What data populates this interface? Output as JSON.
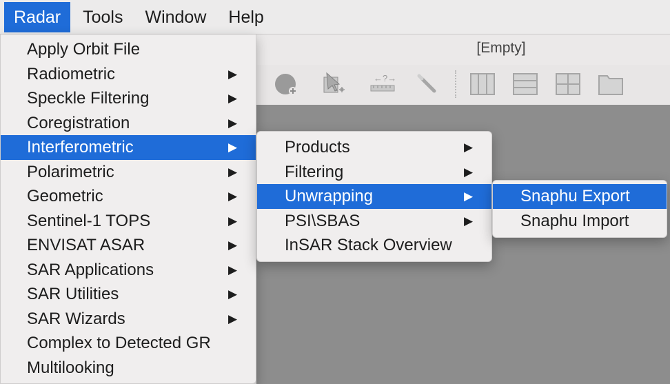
{
  "menubar": {
    "items": [
      {
        "label": "Radar",
        "active": true
      },
      {
        "label": "Tools",
        "active": false
      },
      {
        "label": "Window",
        "active": false
      },
      {
        "label": "Help",
        "active": false
      }
    ]
  },
  "window": {
    "title": "[Empty]"
  },
  "toolbar": {
    "icons": [
      "new-product-icon",
      "select-tool-icon",
      "measure-tool-icon",
      "magic-wand-icon",
      "tile-columns-icon",
      "tile-rows-icon",
      "tile-grid-icon",
      "tile-floating-icon"
    ]
  },
  "radar_menu": {
    "items": [
      {
        "label": "Apply Orbit File",
        "submenu": false
      },
      {
        "label": "Radiometric",
        "submenu": true
      },
      {
        "label": "Speckle Filtering",
        "submenu": true
      },
      {
        "label": "Coregistration",
        "submenu": true
      },
      {
        "label": "Interferometric",
        "submenu": true,
        "highlight": true
      },
      {
        "label": "Polarimetric",
        "submenu": true
      },
      {
        "label": "Geometric",
        "submenu": true
      },
      {
        "label": "Sentinel-1 TOPS",
        "submenu": true
      },
      {
        "label": "ENVISAT ASAR",
        "submenu": true
      },
      {
        "label": "SAR Applications",
        "submenu": true
      },
      {
        "label": "SAR Utilities",
        "submenu": true
      },
      {
        "label": "SAR Wizards",
        "submenu": true
      },
      {
        "label": "Complex to Detected GR",
        "submenu": false
      },
      {
        "label": "Multilooking",
        "submenu": false
      }
    ]
  },
  "interferometric_menu": {
    "items": [
      {
        "label": "Products",
        "submenu": true
      },
      {
        "label": "Filtering",
        "submenu": true
      },
      {
        "label": "Unwrapping",
        "submenu": true,
        "highlight": true
      },
      {
        "label": "PSI\\SBAS",
        "submenu": true
      },
      {
        "label": "InSAR Stack Overview",
        "submenu": false
      }
    ]
  },
  "unwrapping_menu": {
    "items": [
      {
        "label": "Snaphu Export",
        "highlight": true
      },
      {
        "label": "Snaphu Import"
      }
    ]
  },
  "arrow_glyph": "▶",
  "colors": {
    "highlight": "#1f6cd8",
    "canvas": "#8d8d8d"
  }
}
